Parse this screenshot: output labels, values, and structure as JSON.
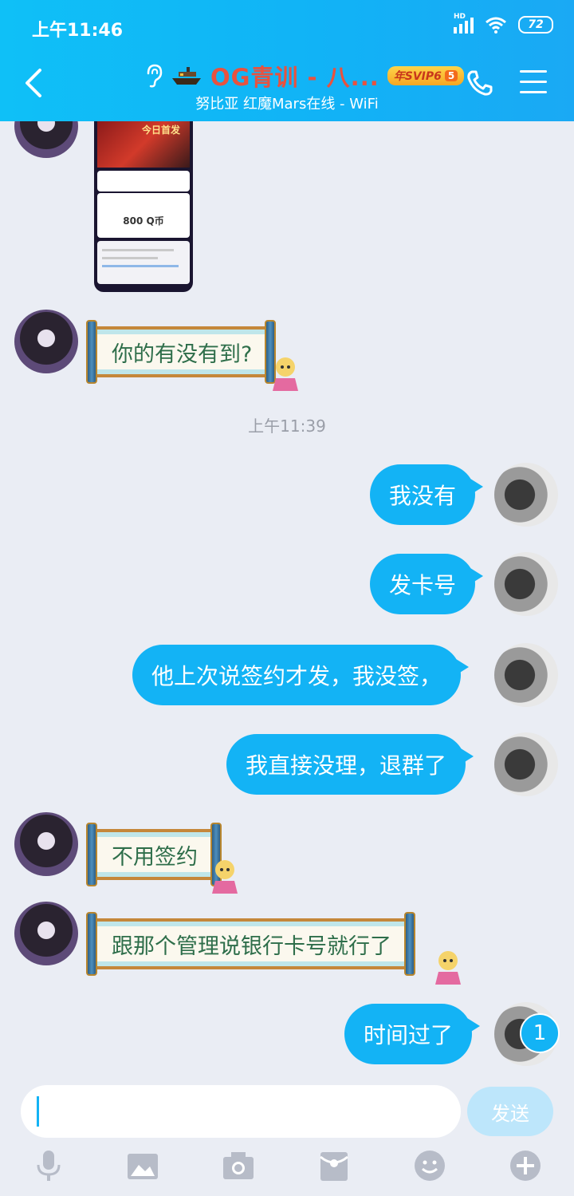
{
  "status_bar": {
    "time": "上午11:46",
    "network": "HD",
    "battery": "72"
  },
  "header": {
    "title": "OG青训 - 八...",
    "badge_prefix": "年SVIP6",
    "badge_level": "5",
    "subtitle": "努比亚 红魔Mars在线 - WiFi"
  },
  "image_message": {
    "banner_text": "今日首发",
    "amount": "800 Q币"
  },
  "messages": {
    "m1": "你的有没有到?",
    "time_sep": "上午11:39",
    "m2": "我没有",
    "m3": "发卡号",
    "m4": "他上次说签约才发，我没签，",
    "m5": "我直接没理，退群了",
    "m6": "不用签约",
    "m7": "跟那个管理说银行卡号就行了",
    "m8": "时间过了"
  },
  "unread_count": "1",
  "input": {
    "placeholder": "",
    "send_label": "发送"
  },
  "colors": {
    "accent": "#13b3f5",
    "header_gradient_start": "#0fc0f7",
    "background": "#eaedf4"
  },
  "toolbar_icons": [
    "mic-icon",
    "image-icon",
    "camera-icon",
    "red-packet-icon",
    "emoji-icon",
    "plus-icon"
  ]
}
